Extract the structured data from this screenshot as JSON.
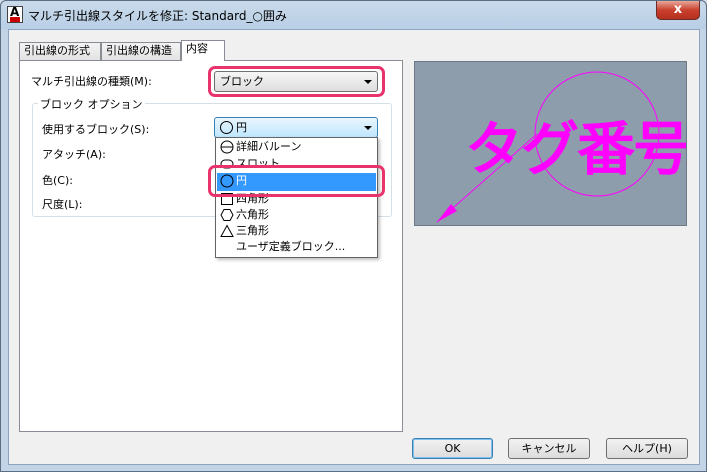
{
  "window": {
    "title": "マルチ引出線スタイルを修正: Standard_○囲み",
    "close_label": "x"
  },
  "tabs": [
    {
      "label": "引出線の形式",
      "active": false
    },
    {
      "label": "引出線の構造",
      "active": false
    },
    {
      "label": "内容",
      "active": true
    }
  ],
  "content": {
    "type_label": "マルチ引出線の種類(M):",
    "type_value": "ブロック",
    "block_options_title": "ブロック オプション",
    "use_block_label": "使用するブロック(S):",
    "use_block_value": "円",
    "attach_label": "アタッチ(A):",
    "color_label": "色(C):",
    "scale_label": "尺度(L):"
  },
  "dropdown": {
    "items": [
      {
        "label": "詳細バルーン",
        "icon": "detail-balloon-icon",
        "selected": false
      },
      {
        "label": "スロット",
        "icon": "slot-icon",
        "selected": false
      },
      {
        "label": "円",
        "icon": "circle-icon",
        "selected": true
      },
      {
        "label": "四角形",
        "icon": "square-icon",
        "selected": false
      },
      {
        "label": "六角形",
        "icon": "hexagon-icon",
        "selected": false
      },
      {
        "label": "三角形",
        "icon": "triangle-icon",
        "selected": false
      },
      {
        "label": "ユーザ定義ブロック...",
        "icon": "",
        "selected": false
      }
    ]
  },
  "preview": {
    "text": "タグ番号",
    "color": "#ff00ff",
    "background": "#8d9dab"
  },
  "buttons": {
    "ok": "OK",
    "cancel": "キャンセル",
    "help": "ヘルプ(H)"
  },
  "colors": {
    "highlight": "#e8336d",
    "selection": "#3399ff"
  }
}
